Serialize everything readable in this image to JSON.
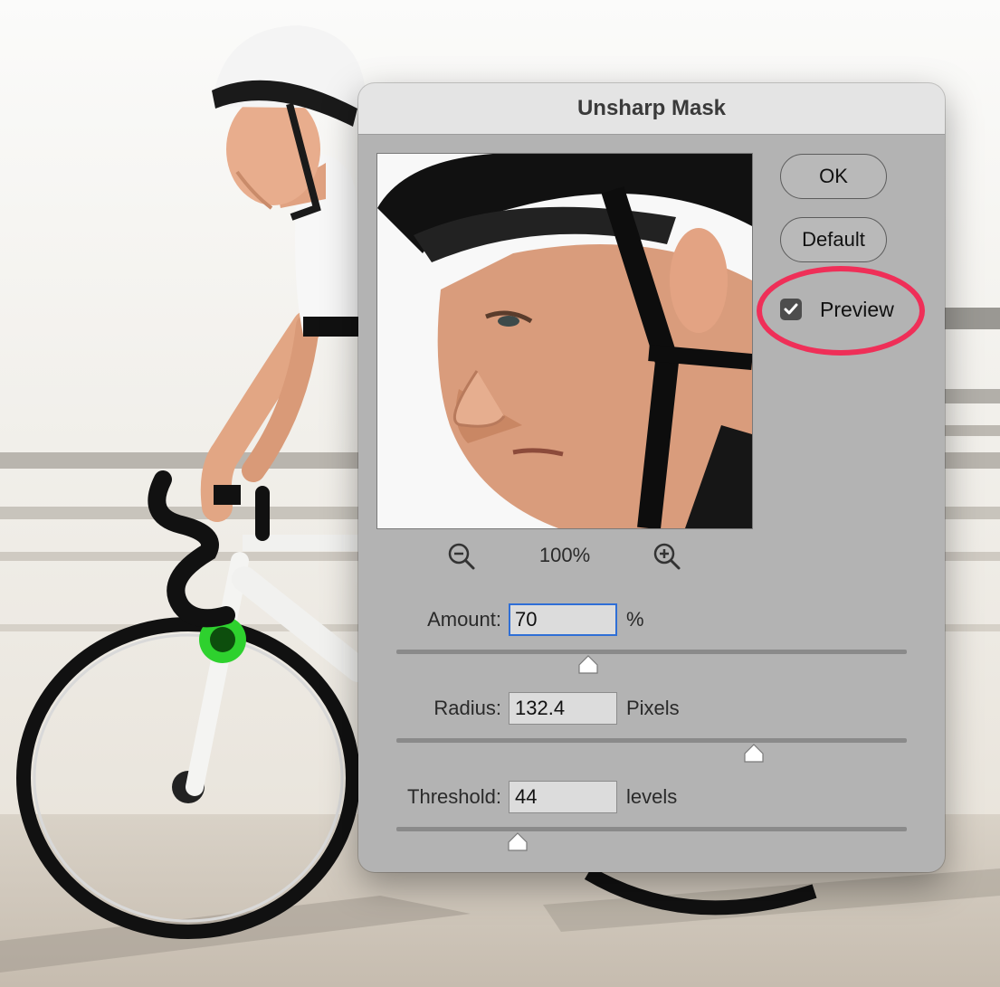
{
  "dialog": {
    "title": "Unsharp Mask",
    "buttons": {
      "ok_label": "OK",
      "default_label": "Default"
    },
    "preview": {
      "label": "Preview",
      "checked": true
    },
    "zoom": {
      "level": "100%"
    },
    "params": [
      {
        "label": "Amount:",
        "value": "70",
        "unit": "%",
        "slider_fraction": 0.375,
        "focused": true
      },
      {
        "label": "Radius:",
        "value": "132.4",
        "unit": "Pixels",
        "slider_fraction": 0.7,
        "focused": false
      },
      {
        "label": "Threshold:",
        "value": "44",
        "unit": "levels",
        "slider_fraction": 0.237,
        "focused": false
      }
    ]
  },
  "colors": {
    "dialog_bg": "#b3b3b3",
    "titlebar_bg": "#e4e4e4",
    "focus_ring": "#2f6fd6",
    "highlight_oval": "#ef2f58"
  },
  "icons": {
    "zoom_out": "zoom-out-magnifier-icon",
    "zoom_in": "zoom-in-magnifier-icon",
    "checkbox": "checkmark-icon"
  }
}
